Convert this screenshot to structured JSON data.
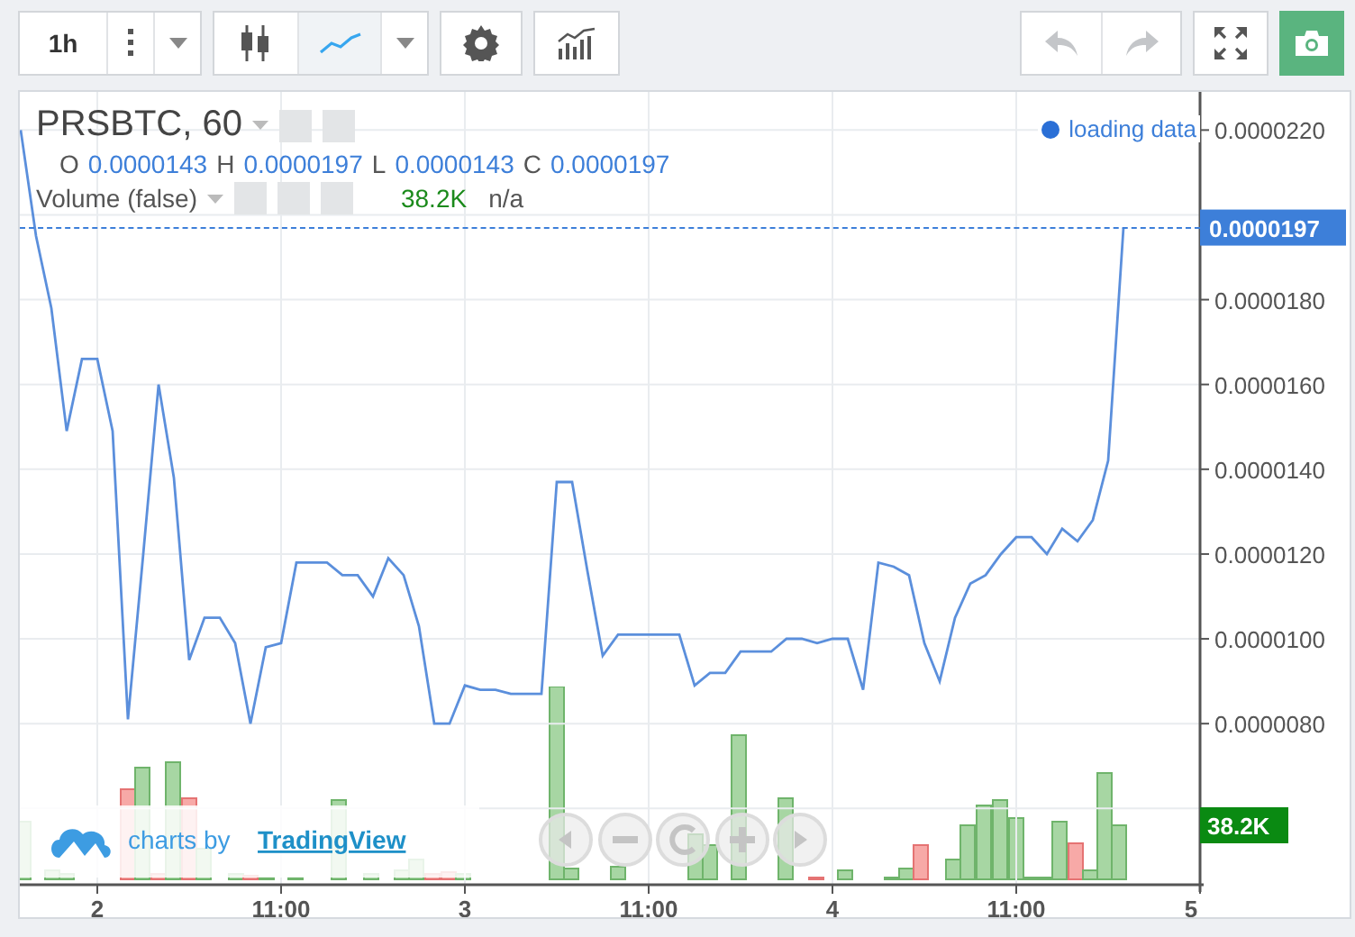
{
  "toolbar": {
    "interval": "1h",
    "chart_types": [
      {
        "kind": "candles",
        "selected": false
      },
      {
        "kind": "line",
        "selected": true
      }
    ],
    "undo": {
      "disabled": true
    },
    "redo": {
      "disabled": true
    }
  },
  "chart": {
    "legend": {
      "symbol": "PRSBTC, 60",
      "ohlc": [
        {
          "label": "O",
          "value": "0.0000143"
        },
        {
          "label": "H",
          "value": "0.0000197"
        },
        {
          "label": "L",
          "value": "0.0000143"
        },
        {
          "label": "C",
          "value": "0.0000197"
        }
      ],
      "volume": {
        "title": "Volume (false)",
        "value": "38.2K",
        "extra": "n/a"
      }
    },
    "status": "loading data",
    "last_price": "0.0000197",
    "volume_label": "38.2K",
    "branding": {
      "prefix": "charts by",
      "link": "TradingView"
    },
    "chart_data": {
      "type": "line",
      "grid": true,
      "ylim": [
        4.2e-06,
        2.29e-05
      ],
      "categories": [
        null,
        null,
        null,
        null,
        null,
        "2",
        null,
        null,
        null,
        null,
        null,
        null,
        null,
        null,
        null,
        null,
        null,
        "11:00",
        null,
        null,
        null,
        null,
        null,
        null,
        null,
        null,
        null,
        null,
        null,
        "3",
        null,
        null,
        null,
        null,
        null,
        null,
        null,
        null,
        null,
        null,
        null,
        "11:00",
        null,
        null,
        null,
        null,
        null,
        null,
        null,
        null,
        null,
        null,
        null,
        "4",
        null,
        null,
        null,
        null,
        null,
        null,
        null,
        null,
        null,
        null,
        null,
        "11:00",
        null,
        null,
        null,
        null,
        null,
        null,
        null,
        null,
        null,
        null,
        null,
        "5"
      ],
      "series": [
        {
          "color": "#5b8fdc",
          "values": [
            2.2e-05,
            1.95e-05,
            1.78e-05,
            1.49e-05,
            1.66e-05,
            1.66e-05,
            1.49e-05,
            8.1e-06,
            1.2e-05,
            1.6e-05,
            1.38e-05,
            9.5e-06,
            1.05e-05,
            1.05e-05,
            9.9e-06,
            8e-06,
            9.8e-06,
            9.9e-06,
            1.18e-05,
            1.18e-05,
            1.18e-05,
            1.15e-05,
            1.15e-05,
            1.1e-05,
            1.19e-05,
            1.15e-05,
            1.03e-05,
            8e-06,
            8e-06,
            8.9e-06,
            8.8e-06,
            8.8e-06,
            8.7e-06,
            8.7e-06,
            8.7e-06,
            1.37e-05,
            1.37e-05,
            1.16e-05,
            9.6e-06,
            1.01e-05,
            1.01e-05,
            1.01e-05,
            1.01e-05,
            1.01e-05,
            8.9e-06,
            9.2e-06,
            9.2e-06,
            9.7e-06,
            9.7e-06,
            9.7e-06,
            1e-05,
            1e-05,
            9.9e-06,
            1e-05,
            1e-05,
            8.8e-06,
            1.18e-05,
            1.17e-05,
            1.15e-05,
            9.9e-06,
            9e-06,
            1.05e-05,
            1.13e-05,
            1.15e-05,
            1.2e-05,
            1.24e-05,
            1.24e-05,
            1.2e-05,
            1.26e-05,
            1.23e-05,
            1.28e-05,
            1.42e-05,
            1.97e-05,
            null,
            null,
            null,
            null,
            null
          ]
        }
      ],
      "yticks": [
        {
          "value": 2.2e-05,
          "label": "0.0000220"
        },
        {
          "value": 1.8e-05,
          "label": "0.0000180"
        },
        {
          "value": 1.6e-05,
          "label": "0.0000160"
        },
        {
          "value": 1.4e-05,
          "label": "0.0000140"
        },
        {
          "value": 1.2e-05,
          "label": "0.0000120"
        },
        {
          "value": 1e-05,
          "label": "0.0000100"
        },
        {
          "value": 8e-06,
          "label": "0.0000080"
        }
      ]
    }
  }
}
